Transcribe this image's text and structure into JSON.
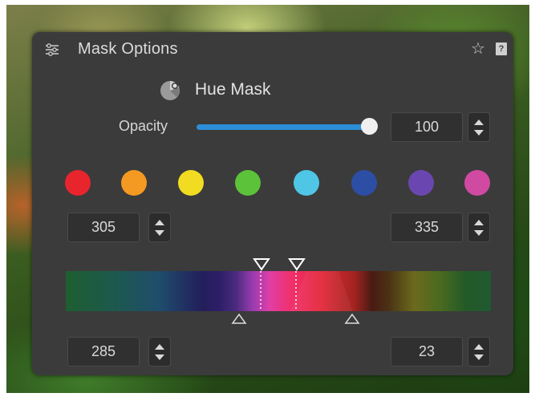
{
  "panel": {
    "title": "Mask Options",
    "icons": {
      "menu": "sliders-icon",
      "favorite": "star-icon",
      "help": "help-icon"
    },
    "help_label": "?"
  },
  "mask_mode": {
    "label": "Hue Mask",
    "icon": "color-wheel-icon"
  },
  "opacity": {
    "label": "Opacity",
    "value": "100",
    "slider_fraction": 1.0,
    "track_color": "#2b8ed6"
  },
  "swatches": [
    {
      "name": "red",
      "color": "#e8242d"
    },
    {
      "name": "orange",
      "color": "#f49a22"
    },
    {
      "name": "yellow",
      "color": "#f2dc22"
    },
    {
      "name": "green",
      "color": "#5cc239"
    },
    {
      "name": "cyan",
      "color": "#4fc6e6"
    },
    {
      "name": "blue",
      "color": "#2d4ea5"
    },
    {
      "name": "purple",
      "color": "#6a47b0"
    },
    {
      "name": "magenta",
      "color": "#d04aa2"
    }
  ],
  "inner_range": {
    "start": "305",
    "end": "335"
  },
  "outer_range": {
    "start": "285",
    "end": "23"
  },
  "colors": {
    "panel_bg": "#3b3b3b",
    "field_bg": "#303030",
    "text": "#d9d9d9"
  }
}
